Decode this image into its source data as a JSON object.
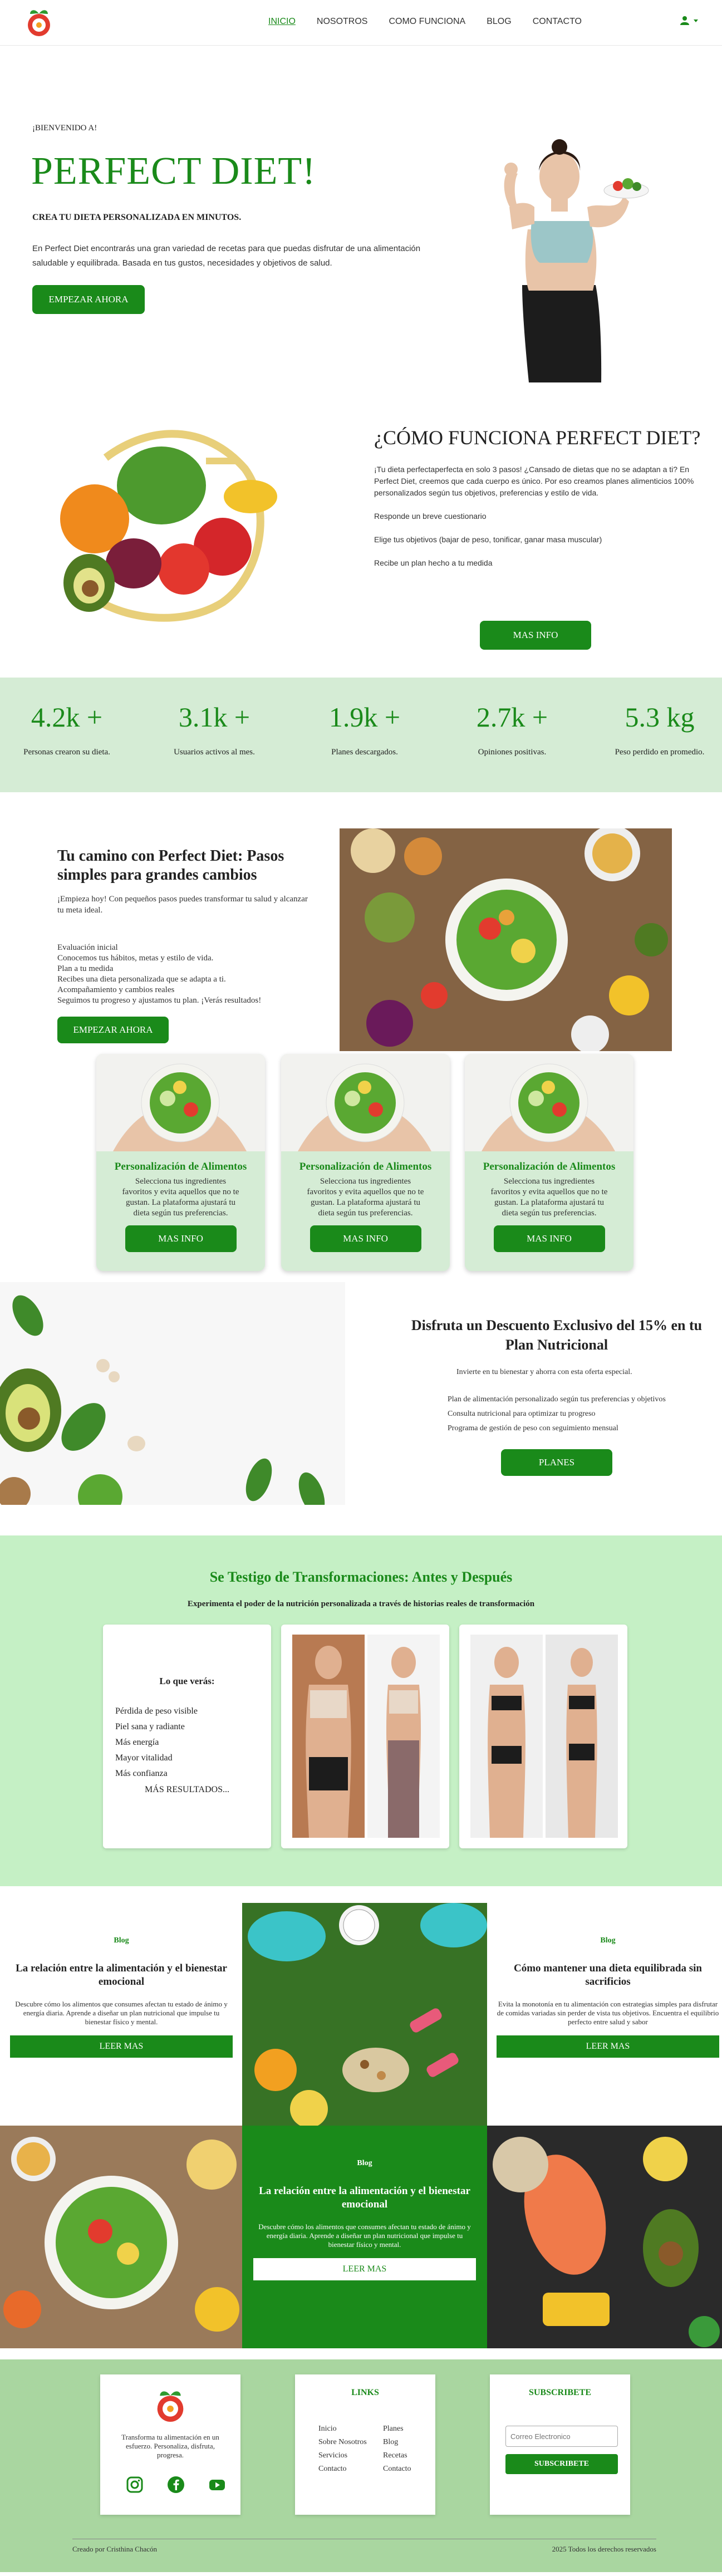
{
  "nav": {
    "items": [
      "INICIO",
      "NOSOTROS",
      "COMO FUNCIONA",
      "BLOG",
      "CONTACTO"
    ],
    "active": "INICIO",
    "user_icon": "user-icon",
    "dropdown_icon": "caret-down-icon"
  },
  "hero": {
    "welcome": "¡BIENVENIDO A!",
    "title": "PERFECT DIET!",
    "subtitle": "CREA TU DIETA PERSONALIZADA EN MINUTOS.",
    "description": "En Perfect Diet encontrarás una gran variedad de recetas para que puedas disfrutar de una alimentación saludable y equilibrada. Basada en tus gustos, necesidades y objetivos de salud.",
    "button": "EMPEZAR AHORA"
  },
  "how": {
    "title": "¿CÓMO FUNCIONA PERFECT DIET?",
    "intro": "¡Tu dieta perfectaperfecta en solo 3 pasos! ¿Cansado de dietas que no se adaptan a ti? En Perfect Diet, creemos que cada cuerpo es único. Por eso creamos planes alimenticios 100% personalizados según tus objetivos, preferencias y estilo de vida.",
    "step1": "Responde un breve cuestionario",
    "step2": "Elige tus objetivos (bajar de peso, tonificar, ganar masa muscular)",
    "step3": "Recibe un plan hecho a tu medida",
    "button": "MAS INFO"
  },
  "stats": [
    {
      "num": "4.2k +",
      "label": "Personas crearon su dieta."
    },
    {
      "num": "3.1k +",
      "label": "Usuarios activos al mes."
    },
    {
      "num": "1.9k +",
      "label": "Planes descargados."
    },
    {
      "num": "2.7k +",
      "label": "Opiniones positivas."
    },
    {
      "num": "5.3 kg",
      "label": "Peso perdido en promedio."
    }
  ],
  "path": {
    "title": "Tu camino con Perfect Diet: Pasos simples para grandes cambios",
    "intro": "¡Empieza hoy! Con pequeños pasos puedes transformar tu salud y alcanzar tu meta ideal.",
    "steps": [
      "Evaluación inicial",
      "Conocemos tus hábitos, metas y estilo de vida.",
      "Plan a tu medida",
      "Recibes una dieta personalizada que se adapta a ti.",
      "Acompañamiento y cambios reales",
      "Seguimos tu progreso y ajustamos tu plan. ¡Verás resultados!"
    ],
    "button": "EMPEZAR AHORA"
  },
  "cards": [
    {
      "title": "Personalización de Alimentos",
      "text": "Selecciona tus ingredientes favoritos y evita aquellos que no te gustan. La plataforma ajustará tu dieta según tus preferencias.",
      "button": "MAS INFO"
    },
    {
      "title": "Personalización de Alimentos",
      "text": "Selecciona tus ingredientes favoritos y evita aquellos que no te gustan. La plataforma ajustará tu dieta según tus preferencias.",
      "button": "MAS INFO"
    },
    {
      "title": "Personalización de Alimentos",
      "text": "Selecciona tus ingredientes favoritos y evita aquellos que no te gustan. La plataforma ajustará tu dieta según tus preferencias.",
      "button": "MAS INFO"
    }
  ],
  "discount": {
    "title": "Disfruta un Descuento Exclusivo del 15% en tu Plan Nutricional",
    "intro": "Invierte en tu bienestar y ahorra con esta oferta especial.",
    "items": [
      "Plan de alimentación personalizado según tus preferencias y objetivos",
      "Consulta nutricional para optimizar tu progreso",
      "Programa de gestión de peso con seguimiento mensual"
    ],
    "button": "PLANES"
  },
  "testimonials": {
    "title": "Se Testigo de Transformaciones: Antes y Después",
    "subtitle": "Experimenta el poder de la nutrición personalizada a través de historias reales de transformación",
    "question": "Lo que verás:",
    "list": [
      "Pérdida de peso visible",
      "Piel sana y radiante",
      "Más energía",
      "Mayor vitalidad",
      "Más confianza"
    ],
    "more": "MÁS RESULTADOS..."
  },
  "blog": [
    {
      "tag": "Blog",
      "title": "La relación entre la alimentación y el bienestar emocional",
      "text": "Descubre cómo los alimentos que consumes afectan tu estado de ánimo y energía diaria. Aprende a diseñar un plan nutricional que impulse tu bienestar físico y mental.",
      "button": "LEER MAS"
    },
    {
      "tag": "Blog",
      "title": "Cómo mantener una dieta equilibrada sin sacrificios",
      "text": "Evita la monotonía en tu alimentación con estrategias simples para disfrutar de comidas variadas sin perder de vista tus objetivos. Encuentra el equilibrio perfecto entre salud y sabor",
      "button": "LEER MAS"
    },
    {
      "tag": "Blog",
      "title": "La relación entre la alimentación y el bienestar emocional",
      "text": "Descubre cómo los alimentos que consumes afectan tu estado de ánimo y energía diaria. Aprende a diseñar un plan nutricional que impulse tu bienestar físico y mental.",
      "button": "LEER MAS"
    }
  ],
  "footer": {
    "tagline": "Transforma tu alimentación en un esfuerzo. Personaliza, disfruta, progresa.",
    "social_icons": [
      "instagram-icon",
      "facebook-icon",
      "youtube-icon"
    ],
    "links_title": "LINKS",
    "links_col1": [
      "Inicio",
      "Sobre Nosotros",
      "Servicios",
      "Contacto"
    ],
    "links_col2": [
      "Planes",
      "Blog",
      "Recetas",
      "Contacto"
    ],
    "subscribe_title": "SUBSCRIBETE",
    "email_placeholder": "Correo Electronico",
    "subscribe_button": "SUBSCRIBETE",
    "credit": "Creado por Cristhina Chacón",
    "rights": "2025 Todos los derechos reservados"
  },
  "colors": {
    "brand_green": "#1a8a1a",
    "light_green": "#d5ecd5",
    "mint": "#c5f0c5",
    "footer_green": "#a9d6a0"
  }
}
